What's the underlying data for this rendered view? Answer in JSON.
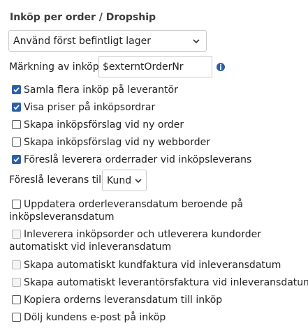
{
  "section_title": "Inköp per order / Dropship",
  "stock_select": {
    "value": "Använd först befintligt lager"
  },
  "marking": {
    "label": "Märkning av inköp:",
    "value": "$externtOrderNr"
  },
  "checkboxes": [
    {
      "label": "Samla flera inköp på leverantör",
      "checked": true
    },
    {
      "label": "Visa priser på inköpsordrar",
      "checked": true
    },
    {
      "label": "Skapa inköpsförslag vid ny order",
      "checked": false
    },
    {
      "label": "Skapa inköpsförslag vid ny webborder",
      "checked": false
    },
    {
      "label": "Föreslå leverera orderrader vid inköpsleverans",
      "checked": true
    }
  ],
  "delivery": {
    "label": "Föreslå leverans till:",
    "value": "Kund"
  },
  "checkboxes2": [
    {
      "line1": "Uppdatera orderleveransdatum beroende på",
      "line2": "inköpsleveransdatum",
      "checked": false,
      "disabled": false
    },
    {
      "line1": "Inleverera inköpsorder och utleverera kundorder",
      "line2": "automatiskt vid inleveransdatum",
      "checked": false,
      "disabled": true
    },
    {
      "label": "Skapa automatiskt kundfaktura vid inleveransdatum",
      "checked": false,
      "disabled": true
    },
    {
      "label": "Skapa automatiskt leverantörsfaktura vid inleveransdatum",
      "checked": false,
      "disabled": true
    },
    {
      "label": "Kopiera orderns leveransdatum till inköp",
      "checked": false,
      "disabled": false
    },
    {
      "label": "Dölj kundens e-post på inköp",
      "checked": false,
      "disabled": false
    }
  ],
  "colors": {
    "accent": "#2b5fa8",
    "info_icon": "#2b5fa8"
  },
  "icons": {
    "select_arrow": "chevron-down-icon",
    "info": "info-icon",
    "check": "checkmark-icon"
  }
}
